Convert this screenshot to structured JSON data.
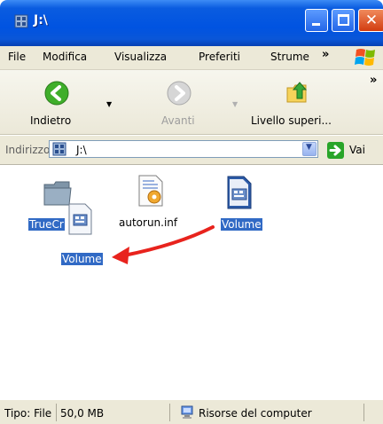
{
  "window": {
    "title": "J:\\",
    "close_glyph": "✕"
  },
  "menu": {
    "items": [
      {
        "label": "File",
        "accel": "F"
      },
      {
        "label": "Modifica",
        "accel": "M"
      },
      {
        "label": "Visualizza",
        "accel": "V"
      },
      {
        "label": "Preferiti",
        "accel": "P"
      },
      {
        "label": "Strumenti",
        "display": "Strume",
        "accel": "S"
      }
    ],
    "overflow": "»"
  },
  "toolbar": {
    "back_label": "Indietro",
    "forward_label": "Avanti",
    "up_label": "Livello superi...",
    "overflow": "»"
  },
  "address": {
    "label": "Indirizzo",
    "value": "J:\\",
    "go_label": "Vai"
  },
  "files": [
    {
      "name": "TrueCrypt",
      "display": "TrueCr",
      "icon": "folder-icon",
      "selected": true
    },
    {
      "name": "autorun.inf",
      "icon": "inf-file-icon",
      "selected": false
    },
    {
      "name": "Volume",
      "icon": "volume-file-icon",
      "selected": true
    }
  ],
  "drag": {
    "label": "Volume",
    "icon": "volume-file-icon",
    "arrow_color": "#e8231d"
  },
  "status": {
    "type": "Tipo: File D",
    "size": "50,0 MB",
    "location": "Risorse del computer"
  },
  "colors": {
    "titlebar": "#0053e1",
    "selection": "#316ac5",
    "chrome": "#ece9d8"
  }
}
